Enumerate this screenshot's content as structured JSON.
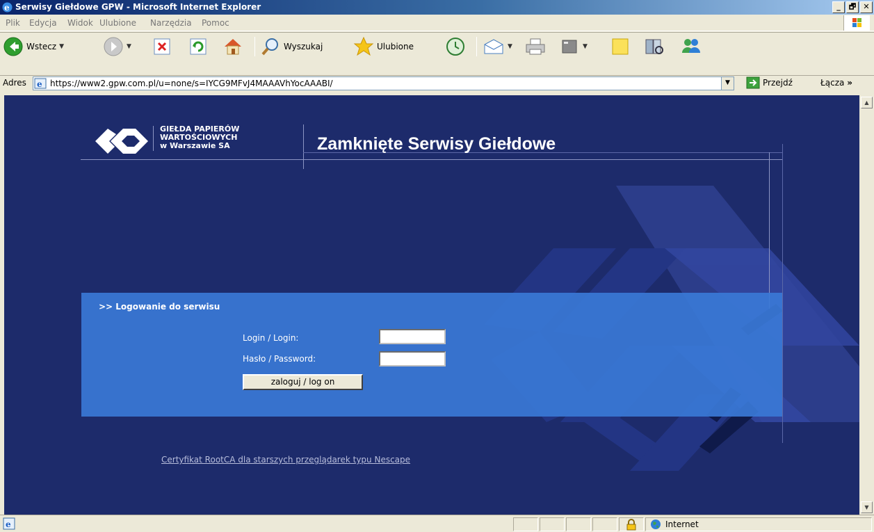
{
  "window": {
    "title": "Serwisy Giełdowe GPW - Microsoft Internet Explorer",
    "minimize": "_",
    "maximize": "🗗",
    "close": "✕"
  },
  "menu": [
    "Plik",
    "Edycja",
    "Widok",
    "Ulubione",
    "Narzędzia",
    "Pomoc"
  ],
  "toolbar": {
    "back_label": "Wstecz",
    "search_label": "Wyszukaj",
    "favorites_label": "Ulubione"
  },
  "address": {
    "label": "Adres",
    "url": "https://www2.gpw.com.pl/u=none/s=IYCG9MFvJ4MAAAVhYocAAABI/",
    "go_label": "Przejdź",
    "links_label": "Łącza",
    "links_more": "»"
  },
  "page": {
    "org_name_line1": "GIEŁDA PAPIERÓW",
    "org_name_line2": "WARTOŚCIOWYCH",
    "org_name_line3": "w Warszawie SA",
    "site_title": "Zamknięte Serwisy Giełdowe",
    "login_heading": ">> Logowanie do serwisu",
    "login_label": "Login / Login:",
    "password_label": "Hasło / Password:",
    "login_value": "",
    "password_value": "",
    "submit_label": "zaloguj / log on",
    "cert_link": "Certyfikat RootCA dla starszych przeglądarek typu Nescape"
  },
  "status": {
    "zone": "Internet"
  },
  "colors": {
    "page_background": "#1d2b6b",
    "login_panel": "#3a78d6",
    "title_gradient_start": "#0a246a"
  }
}
